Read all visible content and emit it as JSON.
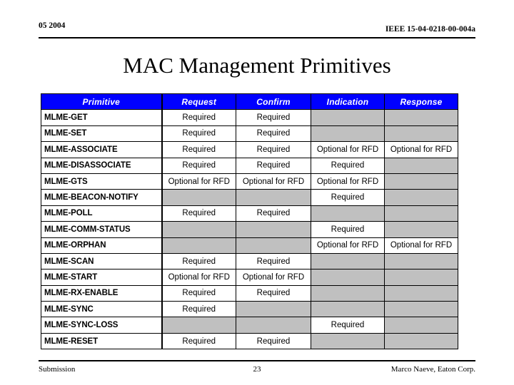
{
  "header": {
    "left": "05 2004",
    "right": "IEEE 15-04-0218-00-004a"
  },
  "title": "MAC Management Primitives",
  "table": {
    "columns": [
      "Primitive",
      "Request",
      "Confirm",
      "Indication",
      "Response"
    ],
    "header_bg": "#0000FF",
    "header_fg": "#FFFFFF",
    "empty_cell_bg": "#C0C0C0",
    "rows": [
      {
        "name": "MLME-GET",
        "request": "Required",
        "confirm": "Required",
        "indication": "",
        "response": ""
      },
      {
        "name": "MLME-SET",
        "request": "Required",
        "confirm": "Required",
        "indication": "",
        "response": ""
      },
      {
        "name": "MLME-ASSOCIATE",
        "request": "Required",
        "confirm": "Required",
        "indication": "Optional for RFD",
        "response": "Optional for RFD"
      },
      {
        "name": "MLME-DISASSOCIATE",
        "request": "Required",
        "confirm": "Required",
        "indication": "Required",
        "response": ""
      },
      {
        "name": "MLME-GTS",
        "request": "Optional for RFD",
        "confirm": "Optional for RFD",
        "indication": "Optional for RFD",
        "response": ""
      },
      {
        "name": "MLME-BEACON-NOTIFY",
        "request": "",
        "confirm": "",
        "indication": "Required",
        "response": ""
      },
      {
        "name": "MLME-POLL",
        "request": "Required",
        "confirm": "Required",
        "indication": "",
        "response": ""
      },
      {
        "name": "MLME-COMM-STATUS",
        "request": "",
        "confirm": "",
        "indication": "Required",
        "response": ""
      },
      {
        "name": "MLME-ORPHAN",
        "request": "",
        "confirm": "",
        "indication": "Optional for RFD",
        "response": "Optional for RFD"
      },
      {
        "name": "MLME-SCAN",
        "request": "Required",
        "confirm": "Required",
        "indication": "",
        "response": ""
      },
      {
        "name": "MLME-START",
        "request": "Optional for RFD",
        "confirm": "Optional for RFD",
        "indication": "",
        "response": ""
      },
      {
        "name": "MLME-RX-ENABLE",
        "request": "Required",
        "confirm": "Required",
        "indication": "",
        "response": ""
      },
      {
        "name": "MLME-SYNC",
        "request": "Required",
        "confirm": "",
        "indication": "",
        "response": ""
      },
      {
        "name": "MLME-SYNC-LOSS",
        "request": "",
        "confirm": "",
        "indication": "Required",
        "response": ""
      },
      {
        "name": "MLME-RESET",
        "request": "Required",
        "confirm": "Required",
        "indication": "",
        "response": ""
      }
    ]
  },
  "footer": {
    "left": "Submission",
    "center": "23",
    "right": "Marco Naeve, Eaton Corp."
  }
}
